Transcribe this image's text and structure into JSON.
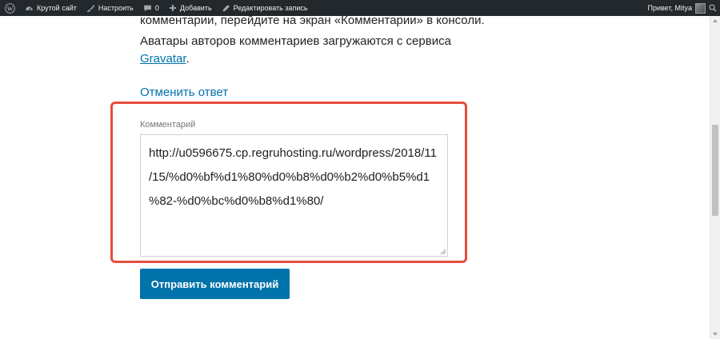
{
  "admin_bar": {
    "site_name": "Крутой сайт",
    "customize": "Настроить",
    "comments_count": "0",
    "add_new": "Добавить",
    "edit_post": "Редактировать запись",
    "greeting": "Привет, Mitya"
  },
  "content": {
    "intro_line1": "комментарии, перейдите на экран «Комментарии» в консоли.",
    "intro_line2": "Аватары авторов комментариев загружаются с сервиса",
    "gravatar_link": "Gravatar",
    "gravatar_period": ".",
    "cancel_reply": "Отменить ответ",
    "comment_label": "Комментарий",
    "comment_lines": [
      "http://u0596675.cp.regruhosting.ru/wordpress/2018/11",
      "/15/%d0%bf%d1%80%d0%b8%d0%b2%d0%b5%d1",
      "%82-%d0%bc%d0%b8%d1%80/"
    ],
    "submit_label": "Отправить комментарий"
  },
  "colors": {
    "admin_bar_bg": "#23282d",
    "link": "#0073aa",
    "button_bg": "#0073aa",
    "highlight_border": "#e74c3c"
  },
  "icons": [
    "wordpress-logo-icon",
    "dashboard-icon",
    "brush-icon",
    "comment-bubble-icon",
    "plus-icon",
    "pencil-icon",
    "search-icon"
  ]
}
